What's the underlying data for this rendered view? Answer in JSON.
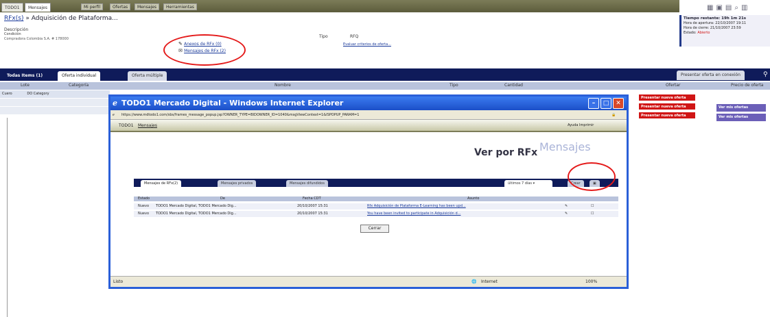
{
  "topnav": {
    "tab_main": "TODO1",
    "tab_mensajes": "Mensajes",
    "links": [
      "Mi perfil",
      "Ofertas",
      "Mensajes",
      "Herramientas"
    ]
  },
  "page": {
    "breadcrumb": "RFx(s)",
    "title": "» Adquisición de Plataforma..."
  },
  "description": {
    "label": "Descripción",
    "condition": "Condición",
    "detail": "Compradora Colombia S.A. # 178000"
  },
  "links": {
    "anexos": "Anexos de RFx (0)",
    "mensajes": "Mensajes de RFx (2)"
  },
  "tipo": {
    "label": "Tipo",
    "value": "RFQ",
    "link": "Evaluar criterios de oferta..."
  },
  "infobox": {
    "title": "Tiempo restante: 19h 1m 21s",
    "line1": "Hora de apertura: 22/10/2007 19:11",
    "line2": "Hora de cierre: 21/10/2007 23:59",
    "status_label": "Estado:",
    "status_value": "Abierto"
  },
  "maintabs": {
    "todas": "Todas Items (1)",
    "individual": "Oferta individual",
    "multiple": "Oferta múltiple",
    "present_btn": "Presentar oferta en conexión"
  },
  "columns": [
    "Lote",
    "Categoría",
    "Nombre",
    "Tipo",
    "Cantidad",
    "Ofertar",
    "Precio de oferta"
  ],
  "rows": [
    {
      "lote": "Cuero",
      "categoria": "DO Category"
    }
  ],
  "side_buttons": {
    "red1": "Presentar nueva oferta",
    "red2": "Presentar nueva oferta",
    "red3": "Presentar nueva oferta",
    "ver1": "Ver mis ofertas",
    "ver2": "Ver mis ofertas"
  },
  "popup": {
    "title": "TODO1 Mercado Digital - Windows Internet Explorer",
    "address": "https://www.mdtodo1.com/sbs/frames_message_popup.jsp?OWNER_TYPE=BIDOWNER_ID=1040&msgViewContext=1&ISPOPUP_PARAM=1",
    "nav_tab": "TODO1",
    "nav_mensajes": "Mensajes",
    "nav_right": "Ayuda  Imprimir",
    "ver_por": "Ver por RFx",
    "watermark": "Mensajes",
    "tabs": [
      "Mensajes de RFx(2)",
      "Mensajes privados",
      "Mensajes difundidos"
    ],
    "filter_value": "últimos 7 días",
    "filter_btn": "Crear",
    "headers": [
      "Estado",
      "De",
      "Fecha CDT",
      "Asunto"
    ],
    "messages": [
      {
        "estado": "Nuevo",
        "de": "TODO1 Mercado Digital, TODO1 Mercado Dig...",
        "fecha": "20/10/2007 15:31",
        "asunto": "Rfx Adquisición de Plataforma E-Learning has been upd..."
      },
      {
        "estado": "Nuevo",
        "de": "TODO1 Mercado Digital, TODO1 Mercado Dig...",
        "fecha": "20/10/2007 15:31",
        "asunto": "You have been invited to participate in Adquisición d..."
      }
    ],
    "cerrar": "Cerrar",
    "status_left": "Listo",
    "status_zone": "Internet",
    "zoom": "100%"
  }
}
